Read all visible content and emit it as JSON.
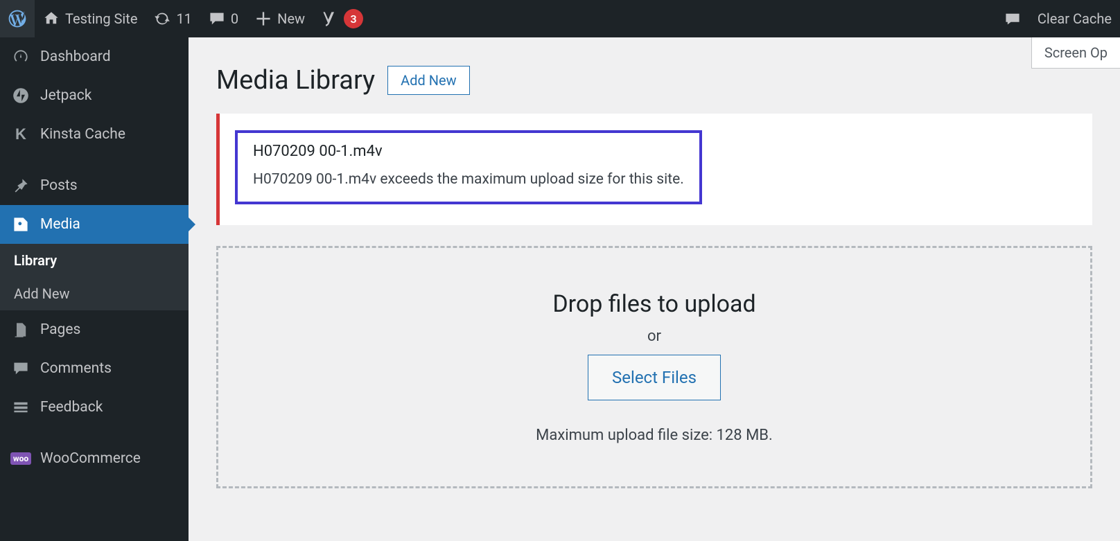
{
  "adminbar": {
    "site_name": "Testing Site",
    "updates_count": "11",
    "comments_count": "0",
    "new_label": "New",
    "yoast_count": "3",
    "clear_cache": "Clear Cache"
  },
  "sidebar": {
    "dashboard": "Dashboard",
    "jetpack": "Jetpack",
    "kinsta": "Kinsta Cache",
    "posts": "Posts",
    "media": "Media",
    "media_sub": {
      "library": "Library",
      "add_new": "Add New"
    },
    "pages": "Pages",
    "comments": "Comments",
    "feedback": "Feedback",
    "woocommerce": "WooCommerce"
  },
  "screen_options": "Screen Op",
  "page_title": "Media Library",
  "add_new_btn": "Add New",
  "notice": {
    "filename": "H070209 00-1.m4v",
    "message": "H070209 00-1.m4v exceeds the maximum upload size for this site."
  },
  "dropzone": {
    "heading": "Drop files to upload",
    "or": "or",
    "select_files": "Select Files",
    "hint": "Maximum upload file size: 128 MB."
  }
}
